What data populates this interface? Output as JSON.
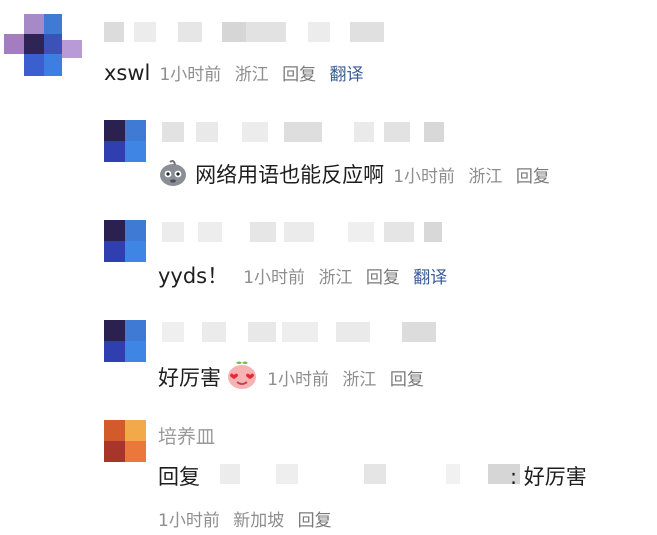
{
  "comments": [
    {
      "text": "xswl",
      "time": "1小时前",
      "location": "浙江",
      "reply": "回复",
      "translate": "翻译"
    }
  ],
  "replies": [
    {
      "text": "网络用语也能反应啊",
      "emoji": "sweat-face-icon",
      "time": "1小时前",
      "location": "浙江",
      "reply": "回复"
    },
    {
      "text": "yyds！",
      "time": "1小时前",
      "location": "浙江",
      "reply": "回复",
      "translate": "翻译"
    },
    {
      "text": "好厉害",
      "emoji": "heart-eyes-peach-icon",
      "time": "1小时前",
      "location": "浙江",
      "reply": "回复"
    },
    {
      "username": "培养皿",
      "reply_prefix": "回复",
      "text": ": 好厉害",
      "time": "1小时前",
      "location": "新加坡",
      "reply": "回复"
    }
  ],
  "colors": {
    "meta": "#8e8e8e",
    "translate_link": "#3a5b95",
    "avatar_blue": "#3b7fd8",
    "avatar_orange": "#e9783a"
  }
}
